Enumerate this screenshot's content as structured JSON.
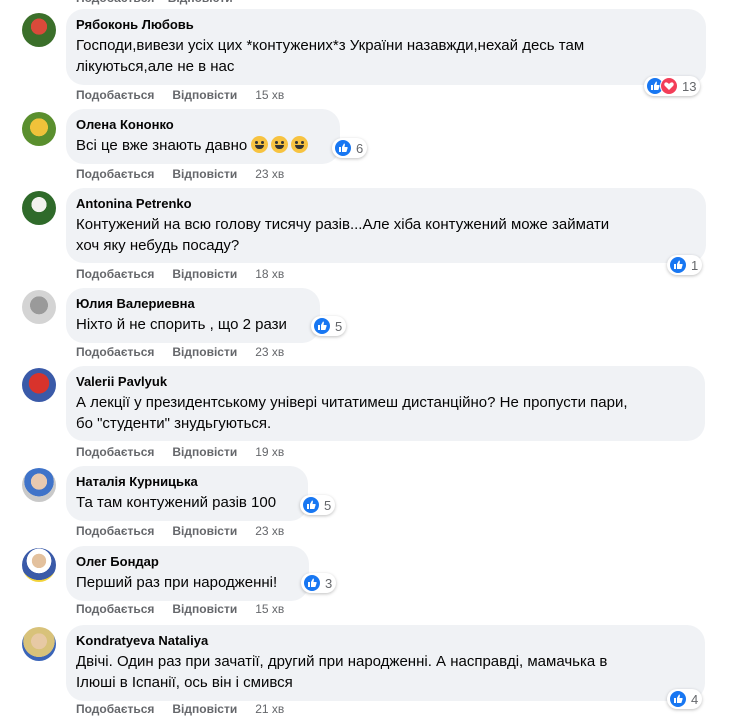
{
  "actions": {
    "like": "Подобається",
    "reply": "Відповісти"
  },
  "top_cut": "Подобається   Відповісти",
  "comments": [
    {
      "author": "Рябоконь Любовь",
      "lines": [
        "Господи,вивези усіх цих *контужених*з України назавжди,нехай десь там",
        "лікуються,але не в нас"
      ],
      "reactions": {
        "types": [
          "like",
          "love"
        ],
        "count": "13"
      },
      "time": "15 хв"
    },
    {
      "author": "Олена Кононко",
      "lines": [
        "Всі це вже знають давно"
      ],
      "emoji_count": 3,
      "reactions": {
        "types": [
          "like"
        ],
        "count": "6"
      },
      "time": "23 хв"
    },
    {
      "author": "Antonina Petrenko",
      "lines": [
        "Контужений на всю голову тисячу разів...Але хіба контужений може займати",
        "хоч яку небудь посаду?"
      ],
      "reactions": {
        "types": [
          "like"
        ],
        "count": "1"
      },
      "time": "18 хв"
    },
    {
      "author": "Юлия Валериевна",
      "lines": [
        "Ніхто й не спорить , що 2 рази"
      ],
      "reactions": {
        "types": [
          "like"
        ],
        "count": "5"
      },
      "time": "23 хв"
    },
    {
      "author": "Valerii Pavlyuk",
      "lines": [
        "А лекції у президентському універі читатимеш дистанційно? Не пропусти пари,",
        "бо \"студенти\" знудьгуються."
      ],
      "reactions": null,
      "time": "19 хв"
    },
    {
      "author": "Наталія Курницька",
      "lines": [
        "Та там контужений разів 100"
      ],
      "reactions": {
        "types": [
          "like"
        ],
        "count": "5"
      },
      "time": "23 хв"
    },
    {
      "author": "Олег Бондар",
      "lines": [
        "Перший раз при народженні!"
      ],
      "reactions": {
        "types": [
          "like"
        ],
        "count": "3"
      },
      "time": "15 хв"
    },
    {
      "author": "Kondratyeva Nataliya",
      "lines": [
        "Двічі. Один раз при зачатії, другий при народженні. А насправді, мамачька в",
        "Ілюші в Іспанії, ось він і смився"
      ],
      "reactions": {
        "types": [
          "like"
        ],
        "count": "4"
      },
      "time": "21 хв"
    }
  ]
}
